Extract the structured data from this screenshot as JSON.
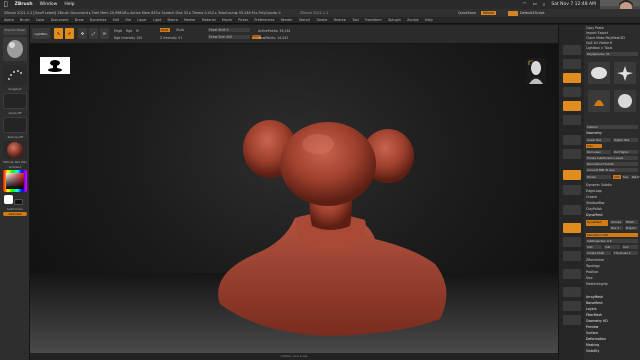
{
  "menubar": {
    "items": [
      "ZBrush",
      "Window",
      "Help"
    ],
    "datetime": "Sat Nov 7  12:48 AM"
  },
  "titlestrip": {
    "info": "ZBrush 2021.1.2 [Geoff Lebell] ZBrush Document    ▸ Free Mem 20.998GB ▸ Active Mem 853 ▸ Scratch Disk 52 ▸ Timer▸ 0.012 ▸ TotalCount▸ 55.248 M ▸ PolyCount▸ 0",
    "center": "ZBrush 2021.1.2",
    "quicksave": "QuickSave",
    "menus": "Menus",
    "defaultzscript": "DefaultZScript"
  },
  "mainmenu": [
    "Alpha",
    "Brush",
    "Color",
    "Document",
    "Draw",
    "Dynamics",
    "Edit",
    "File",
    "Layer",
    "Light",
    "Macro",
    "Marker",
    "Material",
    "Movie",
    "Picker",
    "Preferences",
    "Render",
    "Stencil",
    "Stroke",
    "Texture",
    "Tool",
    "Transform",
    "Zplugin",
    "Zscript",
    "Help"
  ],
  "shelf": {
    "lightbox": "LightBox",
    "edit": "Edit",
    "draw": "Draw",
    "move": "Move",
    "scale": "Scale",
    "rotate": "Rotate",
    "mrgb": "Mrgb",
    "rgb": "Rgb",
    "m": "M",
    "zadd": "Zadd",
    "zsub": "Zsub",
    "focal_shift": "Focal Shift 0",
    "draw_size": "Draw Size 400",
    "dynamic": "Dynamic",
    "rgb_intensity": "Rgb Intensity 100",
    "z_intensity": "Z Intensity 51",
    "active_points": "ActivePoints: 56,181",
    "total_points": "TotalPoints: 14,442"
  },
  "leftpanel": {
    "projection_master": "Projection Master",
    "lightbox_label": "LightBox",
    "stroke_label": "DragRect",
    "alpha_label": "Alpha Off",
    "texture_label": "Texture Off",
    "material_label": "MatCap Red Wax",
    "gradient_label": "Gradient",
    "switch_color": "SwitchColor",
    "alternate": "Alternate"
  },
  "rpanel": {
    "rows": [
      "Copy",
      "Paste",
      "Import",
      "Export",
      "Clone",
      "Make PolyMesh3D",
      "GoZ",
      "All",
      "Visible",
      "R",
      "Lightbox > Tools",
      "PolySphere1. 51",
      "Subtool",
      "Geometry",
      "Lower Res",
      "Higher Res",
      "Sdiv",
      "Del Lower",
      "Del Higher",
      "Freeze SubDivision Levels",
      "Reconstruct Subdiv",
      "Convert BPR To Geo",
      "Divide",
      "Smt",
      "Suv",
      "ReUV",
      "Dynamic Subdiv",
      "EdgeLoop",
      "Crease",
      "ShadowBox",
      "ClayPolish",
      "DynaMesh",
      "DynaMesh",
      "Groups",
      "Polish",
      "Blur 2",
      "Project",
      "Resolution 128",
      "SubProjection 0.6",
      "Add",
      "Sub",
      "And",
      "Create Shell",
      "Thickness 4",
      "ZRemesher",
      "Topology",
      "Position",
      "Size",
      "MeshIntegrity",
      "ArrayMesh",
      "NanoMesh",
      "Layers",
      "FiberMesh",
      "Geometry HD",
      "Preview",
      "Surface",
      "Deformation",
      "Masking",
      "Visibility"
    ]
  },
  "statusbar": "rotation and scale",
  "colors": {
    "accent": "#e08c1e",
    "background": "#1b1b1b",
    "panel": "#2e2e2e",
    "clay": "#9c3f2c"
  },
  "icons": [
    "apple-icon",
    "wifi-icon",
    "battery-icon",
    "search-icon",
    "quick-menu-icon",
    "perspective-icon",
    "floor-icon",
    "local-icon",
    "frame-icon",
    "move-icon",
    "scale-icon",
    "rotate-icon",
    "polyf-icon",
    "transp-icon",
    "solo-icon",
    "xpose-icon",
    "head-navigation-icon"
  ]
}
